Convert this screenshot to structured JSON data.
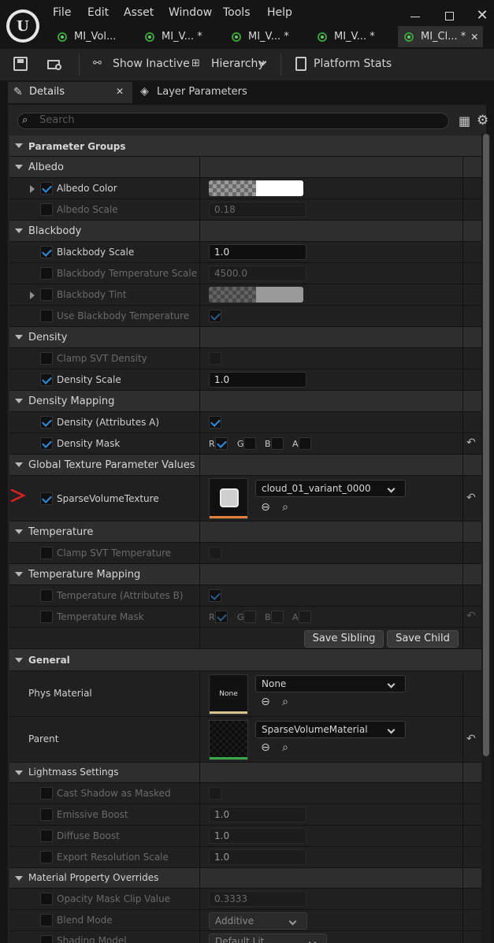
{
  "menu": [
    "File",
    "Edit",
    "Asset",
    "Window",
    "Tools",
    "Help"
  ],
  "tabs": [
    {
      "label": "MI_Vol..."
    },
    {
      "label": "MI_V... *"
    },
    {
      "label": "MI_V... *"
    },
    {
      "label": "MI_V... *"
    },
    {
      "label": "MI_Cl... *"
    }
  ],
  "toolbar": {
    "show_inactive": "Show Inactive",
    "hierarchy": "Hierarchy",
    "platform_stats": "Platform Stats"
  },
  "panel_tabs": {
    "details": "Details",
    "layer_parameters": "Layer Parameters"
  },
  "search": {
    "placeholder": "Search"
  },
  "sections": {
    "parameter_groups": "Parameter Groups",
    "albedo": "Albedo",
    "blackbody": "Blackbody",
    "density": "Density",
    "density_mapping": "Density Mapping",
    "global_texture": "Global Texture Parameter Values",
    "temperature": "Temperature",
    "temperature_mapping": "Temperature Mapping",
    "general": "General",
    "lightmass": "Lightmass Settings",
    "overrides": "Material Property Overrides"
  },
  "props": {
    "albedo_color": "Albedo Color",
    "albedo_scale": "Albedo Scale",
    "albedo_scale_val": "0.18",
    "blackbody_scale": "Blackbody Scale",
    "blackbody_scale_val": "1.0",
    "blackbody_temp_scale": "Blackbody Temperature Scale",
    "blackbody_temp_scale_val": "4500.0",
    "blackbody_tint": "Blackbody Tint",
    "use_blackbody_temp": "Use Blackbody Temperature",
    "clamp_svt_density": "Clamp SVT Density",
    "density_scale": "Density Scale",
    "density_scale_val": "1.0",
    "density_attr_a": "Density (Attributes A)",
    "density_mask": "Density Mask",
    "sparse_volume_texture": "SparseVolumeTexture",
    "svt_value": "cloud_01_variant_0000",
    "clamp_svt_temp": "Clamp SVT Temperature",
    "temp_attr_b": "Temperature (Attributes B)",
    "temp_mask": "Temperature Mask",
    "phys_material": "Phys Material",
    "phys_value": "None",
    "phys_thumb": "None",
    "parent": "Parent",
    "parent_value": "SparseVolumeMaterial",
    "cast_shadow": "Cast Shadow as Masked",
    "emissive_boost": "Emissive Boost",
    "emissive_boost_val": "1.0",
    "diffuse_boost": "Diffuse Boost",
    "diffuse_boost_val": "1.0",
    "export_res": "Export Resolution Scale",
    "export_res_val": "1.0",
    "opacity_mask": "Opacity Mask Clip Value",
    "opacity_mask_val": "0.3333",
    "blend_mode": "Blend Mode",
    "blend_mode_val": "Additive",
    "shading_model": "Shading Model",
    "shading_model_val": "Default Lit"
  },
  "channels": {
    "r": "R",
    "g": "G",
    "b": "B",
    "a": "A"
  },
  "buttons": {
    "save_sibling": "Save Sibling",
    "save_child": "Save Child"
  },
  "colors": {
    "accent": "#2a8fe0",
    "annotation": "#e02020",
    "texture_bar": "#e0803a",
    "none_bar": "#d8c48a",
    "parent_bar": "#3aa64a"
  }
}
